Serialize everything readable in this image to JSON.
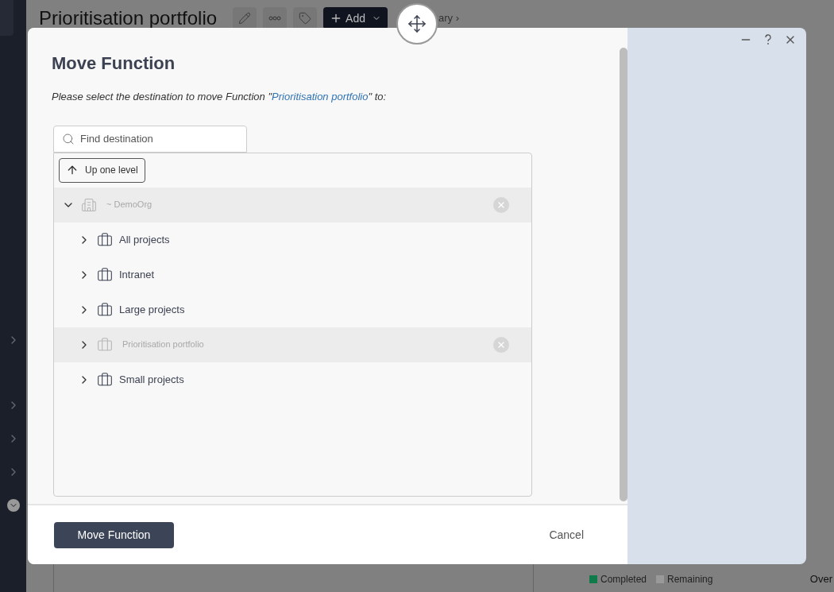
{
  "background": {
    "title": "Prioritisation portfolio",
    "add_button": "Add",
    "breadcrumb": "ary ›",
    "legend": [
      {
        "label": "Completed",
        "color": "#0f7a4a"
      },
      {
        "label": "Remaining",
        "color": "#999999"
      }
    ],
    "edge_text": "Over"
  },
  "dialog": {
    "title": "Move Function",
    "instruction": {
      "prefix": "Please select the destination to move Function \"",
      "link": "Prioritisation portfolio",
      "suffix": "\" to:"
    },
    "search": {
      "placeholder": "Find destination"
    },
    "up_button": "Up one level",
    "tree": [
      {
        "label": "~ DemoOrg",
        "kind": "organisation",
        "expanded": true,
        "disabled": true,
        "children": [
          {
            "label": "All projects",
            "kind": "portfolio",
            "expanded": false,
            "disabled": false
          },
          {
            "label": "Intranet",
            "kind": "portfolio",
            "expanded": false,
            "disabled": false
          },
          {
            "label": "Large projects",
            "kind": "portfolio",
            "expanded": false,
            "disabled": false
          },
          {
            "label": "Prioritisation portfolio",
            "kind": "portfolio",
            "expanded": false,
            "disabled": true
          },
          {
            "label": "Small projects",
            "kind": "portfolio",
            "expanded": false,
            "disabled": false
          }
        ]
      }
    ],
    "primary_button": "Move Function",
    "cancel_button": "Cancel"
  }
}
